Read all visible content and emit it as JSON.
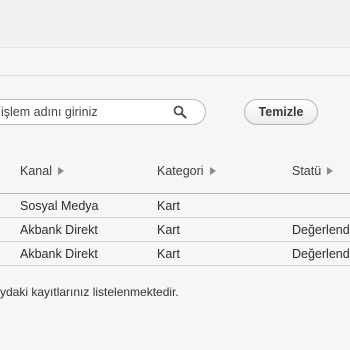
{
  "toolbar": {
    "search_text": "işlem adını giriniz",
    "clear_label": "Temizle"
  },
  "table": {
    "columns": [
      {
        "label": "Kanal"
      },
      {
        "label": "Kategori"
      },
      {
        "label": "Statü"
      }
    ],
    "rows": [
      {
        "kanal": "Sosyal Medya",
        "kategori": "Kart",
        "statu": ""
      },
      {
        "kanal": "Akbank Direkt",
        "kategori": "Kart",
        "statu": "Değerlend"
      },
      {
        "kanal": "Akbank Direkt",
        "kategori": "Kart",
        "statu": "Değerlend"
      }
    ]
  },
  "footer": {
    "message": "ydaki kayıtlarınız listelenmektedir."
  }
}
